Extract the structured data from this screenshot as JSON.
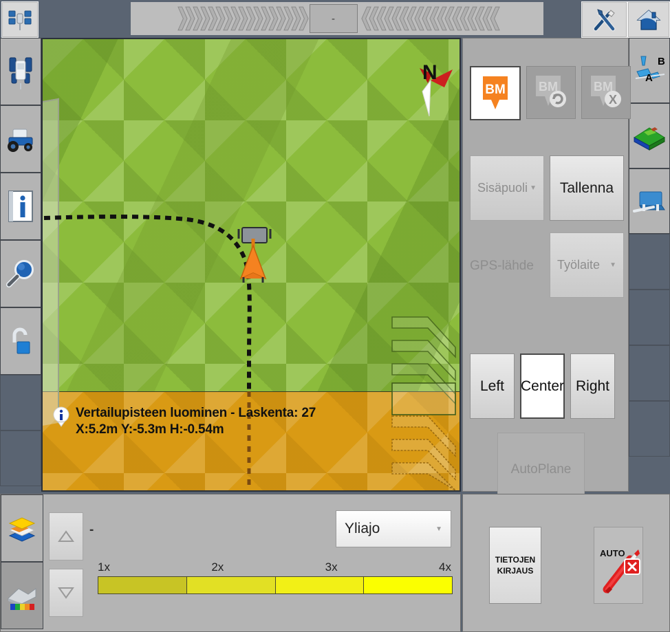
{
  "topbar": {
    "gps_icon": "satellite-icon",
    "tools_icon": "tools-icon",
    "home_icon": "home-icon",
    "lightbar": {
      "center_value": "-",
      "left_chevrons": 17,
      "right_chevrons": 18,
      "chevron_color": "#b0b0b0"
    }
  },
  "left_sidebar": {
    "items": [
      {
        "name": "tractor-top-view",
        "icon": "tractor-top-icon"
      },
      {
        "name": "tractor-side-view",
        "icon": "tractor-side-icon"
      },
      {
        "name": "info",
        "icon": "info-icon"
      },
      {
        "name": "zoom-search",
        "icon": "magnifier-icon"
      },
      {
        "name": "unlock",
        "icon": "padlock-open-icon"
      }
    ],
    "empty_slots": 2
  },
  "right_sidebar": {
    "items": [
      {
        "name": "ab-line",
        "icon": "ab-line-icon",
        "label_a": "A",
        "label_b": "B"
      },
      {
        "name": "terrain-surface",
        "icon": "terrain-icon"
      },
      {
        "name": "implement",
        "icon": "implement-icon"
      }
    ],
    "empty_slots": 4
  },
  "map": {
    "compass_label": "N",
    "vehicle": "vehicle-marker",
    "track": "dashed-guidance-track",
    "boundary": "field-boundary",
    "chevron_markers": 7,
    "info_overlay": {
      "icon": "info-balloon-icon",
      "line1": "Vertailupisteen luominen - Laskenta: 27",
      "line2": "X:5.2m Y:-5.3m H:-0.54m"
    },
    "colors": {
      "field_green": "#8cbc3c",
      "worked_amber": "#d99a14",
      "track": "#1a1a1a"
    }
  },
  "right_panel": {
    "benchmarks": [
      {
        "label": "BM",
        "state": "active",
        "badge": "none"
      },
      {
        "label": "BM",
        "state": "disabled",
        "badge": "refresh"
      },
      {
        "label": "BM",
        "state": "disabled",
        "badge": "x"
      }
    ],
    "inside_dropdown": {
      "value": "Sisäpuoli",
      "state": "disabled"
    },
    "save_button": {
      "label": "Tallenna",
      "state": "enabled"
    },
    "gps_source_label": "GPS-lähde",
    "gps_source_dropdown": {
      "value": "Työlaite",
      "state": "disabled"
    },
    "position_buttons": [
      {
        "label": "Left",
        "selected": false
      },
      {
        "label": "Center",
        "selected": true
      },
      {
        "label": "Right",
        "selected": false
      }
    ],
    "autoplane_button": {
      "label": "AutoPlane",
      "state": "disabled"
    },
    "accent_color": "#f58220"
  },
  "bottom_left": {
    "layers_icon": "layers-icon",
    "profile_icon": "terrain-profile-icon",
    "up_button": {
      "icon": "triangle-up-icon",
      "state": "disabled"
    },
    "down_button": {
      "icon": "triangle-down-icon",
      "state": "disabled"
    },
    "value": "-",
    "mode_dropdown": {
      "value": "Yliajo"
    },
    "overlap_scale": {
      "ticks": [
        "1x",
        "2x",
        "3x",
        "4x"
      ],
      "colors": [
        "#c8c425",
        "#e2e024",
        "#f2f016",
        "#fbff00"
      ]
    }
  },
  "bottom_right": {
    "log_button": {
      "line1": "TIETOJEN",
      "line2": "KIRJAUS"
    },
    "auto_button": {
      "label": "AUTO",
      "icon": "pen-cancel-icon",
      "accent": "#e02020"
    }
  }
}
